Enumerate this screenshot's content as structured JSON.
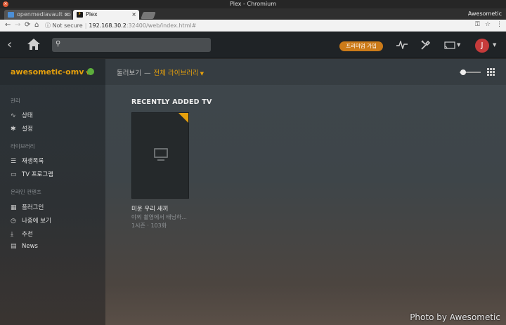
{
  "window": {
    "title": "Plex - Chromium"
  },
  "browser": {
    "tabs": [
      {
        "label": "openmediavault co",
        "active": false
      },
      {
        "label": "Plex",
        "active": true
      }
    ],
    "profile": "Awesometic",
    "security": "Not secure",
    "url_host": "192.168.30.2",
    "url_path": ":32400/web/index.html#"
  },
  "plex": {
    "search_placeholder": "",
    "premium_button": "프리미엄 가입",
    "avatar_initial": "J",
    "server": "awesometic-omv",
    "sidebar": {
      "sections": [
        {
          "title": "관리",
          "items": [
            {
              "label": "상태",
              "icon": "activity-icon"
            },
            {
              "label": "설정",
              "icon": "gear-icon"
            }
          ]
        },
        {
          "title": "라이브러리",
          "items": [
            {
              "label": "재생목록",
              "icon": "list-icon"
            },
            {
              "label": "TV 프로그램",
              "icon": "tv-icon"
            }
          ]
        },
        {
          "title": "온라인 컨텐츠",
          "items": [
            {
              "label": "플러그인",
              "icon": "grid-icon"
            },
            {
              "label": "나중에 보기",
              "icon": "clock-icon"
            },
            {
              "label": "추천",
              "icon": "download-icon"
            },
            {
              "label": "News",
              "icon": "news-icon"
            }
          ]
        }
      ]
    },
    "breadcrumb": {
      "browse": "둘러보기",
      "separator": "—",
      "library": "전체 라이브러리"
    },
    "section_title": "RECENTLY ADDED TV",
    "item": {
      "title": "미운 우리 새끼",
      "subtitle": "야외 촬영에서 태닝하...",
      "meta": "1시즌 · 103화"
    }
  },
  "watermark": "Photo by Awesometic",
  "colors": {
    "accent": "#e5a00d",
    "premium": "#cc7b19",
    "avatar": "#c63b3b"
  }
}
